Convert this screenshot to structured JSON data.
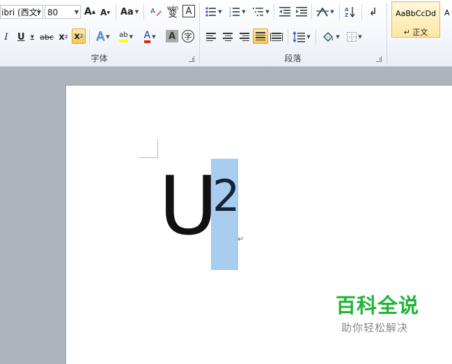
{
  "ribbon": {
    "font_group": {
      "label": "字体",
      "font_name": "ibri (西文i",
      "font_size": "80",
      "grow_font": "A",
      "shrink_font": "A",
      "change_case": "Aa",
      "phonetic": "wén",
      "char_border": "A",
      "italic": "I",
      "underline": "U",
      "strikethrough": "abc",
      "subscript": "x",
      "superscript": "x",
      "highlight": "ab",
      "font_color": "A",
      "char_shading": "A",
      "enclose": "字"
    },
    "paragraph_group": {
      "label": "段落"
    },
    "styles_group": {
      "sample_text": "AaBbCcDd",
      "style_name": "↵ 正文",
      "next_sample": "A"
    }
  },
  "document": {
    "base_char": "U",
    "superscript_char": "2",
    "paragraph_mark": "↵"
  },
  "watermark": {
    "title": "百科全说",
    "subtitle": "助你轻松解决"
  },
  "colors": {
    "selection": "#a8cdee",
    "watermark_green": "#20b436",
    "active_button": "#f7c852"
  }
}
